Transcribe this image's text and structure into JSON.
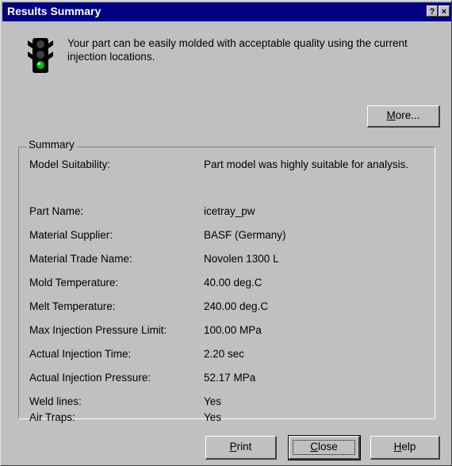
{
  "window": {
    "title": "Results Summary",
    "help_button": "?",
    "close_button": "×"
  },
  "message": "Your part can be easily molded with acceptable quality using the current injection locations.",
  "more_button": {
    "prefix": "",
    "underline": "M",
    "rest": "ore..."
  },
  "summary": {
    "label": "Summary",
    "rows": [
      {
        "label": "Model Suitability:",
        "value": "Part model was highly suitable for analysis."
      },
      {
        "label": "Part Name:",
        "value": "icetray_pw"
      },
      {
        "label": "Material Supplier:",
        "value": "BASF (Germany)"
      },
      {
        "label": "Material Trade Name:",
        "value": "Novolen 1300 L"
      },
      {
        "label": "Mold Temperature:",
        "value": "40.00 deg.C"
      },
      {
        "label": "Melt Temperature:",
        "value": "240.00 deg.C"
      },
      {
        "label": "Max Injection Pressure Limit:",
        "value": "100.00 MPa"
      },
      {
        "label": "Actual Injection Time:",
        "value": "2.20 sec"
      },
      {
        "label": "Actual Injection Pressure:",
        "value": "52.17 MPa"
      },
      {
        "label": "Weld lines:",
        "value": "Yes"
      },
      {
        "label": "Air Traps:",
        "value": "Yes"
      }
    ]
  },
  "buttons": {
    "print": {
      "underline": "P",
      "rest": "rint"
    },
    "close": {
      "underline": "C",
      "rest": "lose"
    },
    "help": {
      "underline": "H",
      "rest": "elp"
    }
  },
  "traffic_light": {
    "icon": "traffic-light-icon",
    "active": "green",
    "colors": {
      "green": "#00c000",
      "off": "#404040"
    }
  }
}
